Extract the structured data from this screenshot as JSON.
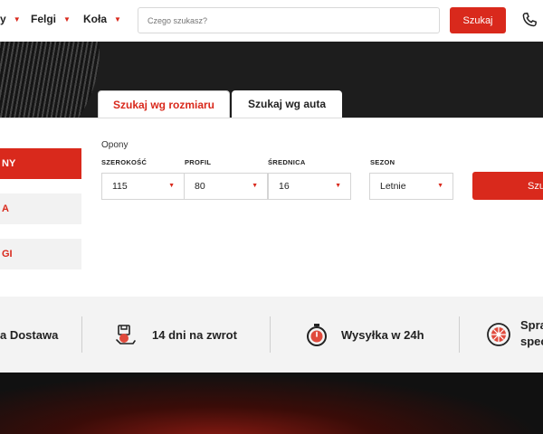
{
  "header": {
    "nav": [
      {
        "label": "y"
      },
      {
        "label": "Felgi"
      },
      {
        "label": "Koła"
      }
    ],
    "search_placeholder": "Czego szukasz?",
    "search_button": "Szukaj"
  },
  "tabs": [
    {
      "label": "Szukaj wg rozmiaru",
      "active": true
    },
    {
      "label": "Szukaj wg auta",
      "active": false
    }
  ],
  "sidebar": {
    "items": [
      {
        "label": "NY",
        "active": true
      },
      {
        "label": "A",
        "active": false
      },
      {
        "label": "GI",
        "active": false
      }
    ]
  },
  "form": {
    "title": "Opony",
    "fields": [
      {
        "label": "SZEROKOŚĆ",
        "value": "115"
      },
      {
        "label": "PROFIL",
        "value": "80"
      },
      {
        "label": "ŚREDNICA",
        "value": "16"
      },
      {
        "label": "SEZON",
        "value": "Letnie"
      }
    ],
    "submit": "Szu"
  },
  "benefits": [
    {
      "label": "a Dostawa"
    },
    {
      "label": "14 dni na zwrot"
    },
    {
      "label": "Wysyłka w 24h"
    },
    {
      "label": "Spra",
      "label2": "spec"
    }
  ],
  "colors": {
    "accent": "#d9291c",
    "dark": "#1d1d1d",
    "strip": "#f3f3f3"
  }
}
